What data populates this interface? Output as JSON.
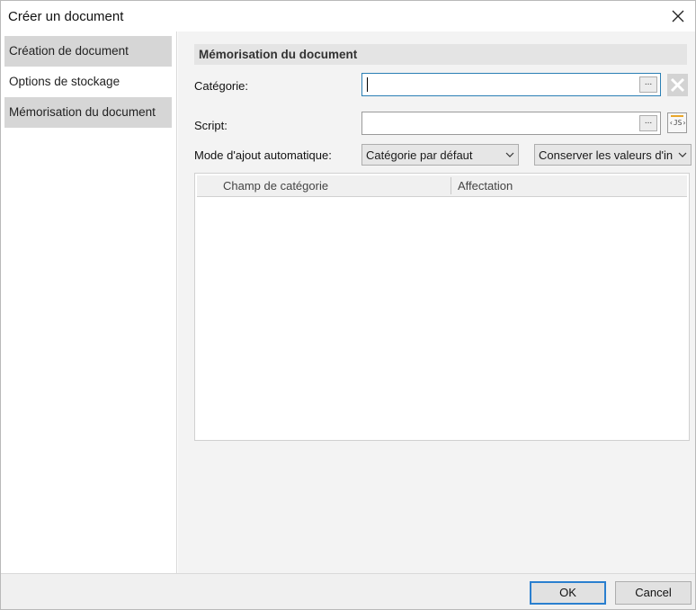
{
  "window": {
    "title": "Créer un document"
  },
  "sidebar": {
    "items": [
      {
        "label": "Création de document",
        "selected": true
      },
      {
        "label": "Options de stockage",
        "selected": false
      },
      {
        "label": "Mémorisation du document",
        "selected": true
      }
    ]
  },
  "main": {
    "section_title": "Mémorisation du document",
    "category": {
      "label": "Catégorie:",
      "value": "",
      "browse_label": "..."
    },
    "script": {
      "label": "Script:",
      "value": "",
      "browse_label": "...",
      "js_icon_text": "‹JS›"
    },
    "auto_add": {
      "label": "Mode d'ajout automatique:",
      "mode_value": "Catégorie par défaut",
      "values_option": "Conserver les valeurs d'in"
    },
    "grid": {
      "columns": [
        "Champ de catégorie",
        "Affectation"
      ],
      "rows": []
    }
  },
  "footer": {
    "ok_label": "OK",
    "cancel_label": "Cancel"
  },
  "colors": {
    "accent": "#2a7fcf",
    "selection": "#d6d6d6",
    "content_bg": "#f3f3f3"
  }
}
